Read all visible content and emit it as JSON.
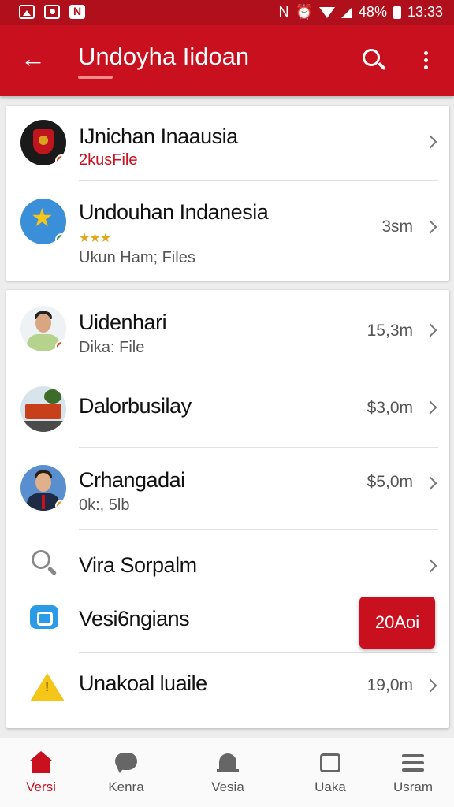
{
  "status_bar": {
    "battery": "48%",
    "time": "13:33"
  },
  "app_bar": {
    "title": "Undoyha Iidoan"
  },
  "list_top": [
    {
      "title": "IJnichan Inaausia",
      "subtitle": "2kusFile",
      "size": "",
      "avatar": "emblem-icon",
      "dot_color": "#e04a1e"
    },
    {
      "title": "Undouhan Indanesia",
      "rating": "★★★",
      "subtitle": "Ukun Ham; Files",
      "size": "3sm",
      "avatar": "star-icon",
      "dot_color": "#2e9a3a"
    }
  ],
  "list_main": [
    {
      "title": "Uidenhari",
      "subtitle": "Dika: File",
      "size": "15,3m",
      "avatar": "person",
      "dot_color": "#e04a1e"
    },
    {
      "title": "Dalorbusilay",
      "subtitle": "",
      "size": "$3,0m",
      "avatar": "truck"
    },
    {
      "title": "Crhangadai",
      "subtitle": "0k:, 5lb",
      "size": "$5,0m",
      "avatar": "suit",
      "dot_color": "#e69a1e"
    },
    {
      "title": "Vira Sorpalm",
      "subtitle": "",
      "size": "",
      "icon": "search-icon"
    },
    {
      "title": "Vesi6ngians",
      "subtitle": "",
      "size": "",
      "icon": "chat-icon"
    },
    {
      "title": "Unakoal luaile",
      "subtitle": "",
      "size": "19,0m",
      "icon": "warning-icon"
    }
  ],
  "floating_badge": {
    "label": "20Aoi"
  },
  "bottom_nav": [
    {
      "label": "Versi",
      "icon": "home-icon",
      "active": true
    },
    {
      "label": "Kenra",
      "icon": "chat-icon",
      "active": false
    },
    {
      "label": "Vesia",
      "icon": "bell-icon",
      "active": false
    },
    {
      "label": "Uaka",
      "icon": "box-icon",
      "active": false
    },
    {
      "label": "Usram",
      "icon": "list-icon",
      "active": false
    }
  ],
  "colors": {
    "primary": "#c8101e",
    "status_bar": "#b0101c",
    "accent_star": "#e0a81e"
  }
}
